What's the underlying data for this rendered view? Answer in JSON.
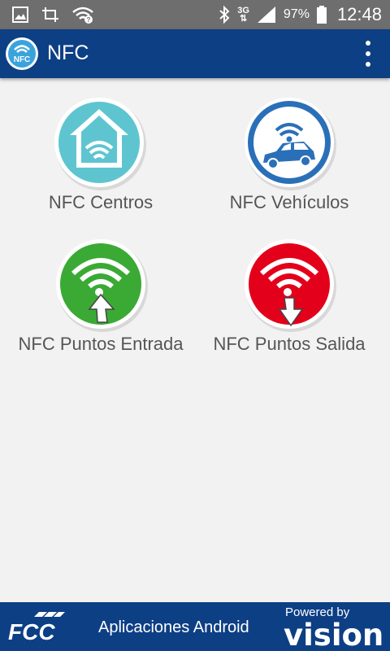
{
  "status_bar": {
    "battery_percent": "97%",
    "time": "12:48",
    "network_type": "3G",
    "icons": [
      "image-icon",
      "screenshot-icon",
      "wifi-question-icon",
      "bluetooth-icon",
      "signal-icon",
      "battery-icon"
    ]
  },
  "app_bar": {
    "title": "NFC",
    "logo_text": "NFC",
    "menu_icon": "overflow-menu-icon"
  },
  "grid": {
    "items": [
      {
        "label": "NFC Centros",
        "icon": "house-nfc-icon",
        "color": "#5ec5d0"
      },
      {
        "label": "NFC Vehículos",
        "icon": "car-nfc-icon",
        "color": "#2a70b8"
      },
      {
        "label": "NFC Puntos Entrada",
        "icon": "entry-nfc-icon",
        "color": "#3aaa35"
      },
      {
        "label": "NFC Puntos Salida",
        "icon": "exit-nfc-icon",
        "color": "#e3001b"
      }
    ]
  },
  "footer": {
    "brand": "FCC",
    "text": "Aplicaciones Android",
    "powered_by": "Powered by",
    "vision_logo": "vision"
  },
  "colors": {
    "primary": "#0d3f85",
    "status_bar": "#6e6e6e",
    "background": "#f2f2f2",
    "label": "#555555"
  }
}
